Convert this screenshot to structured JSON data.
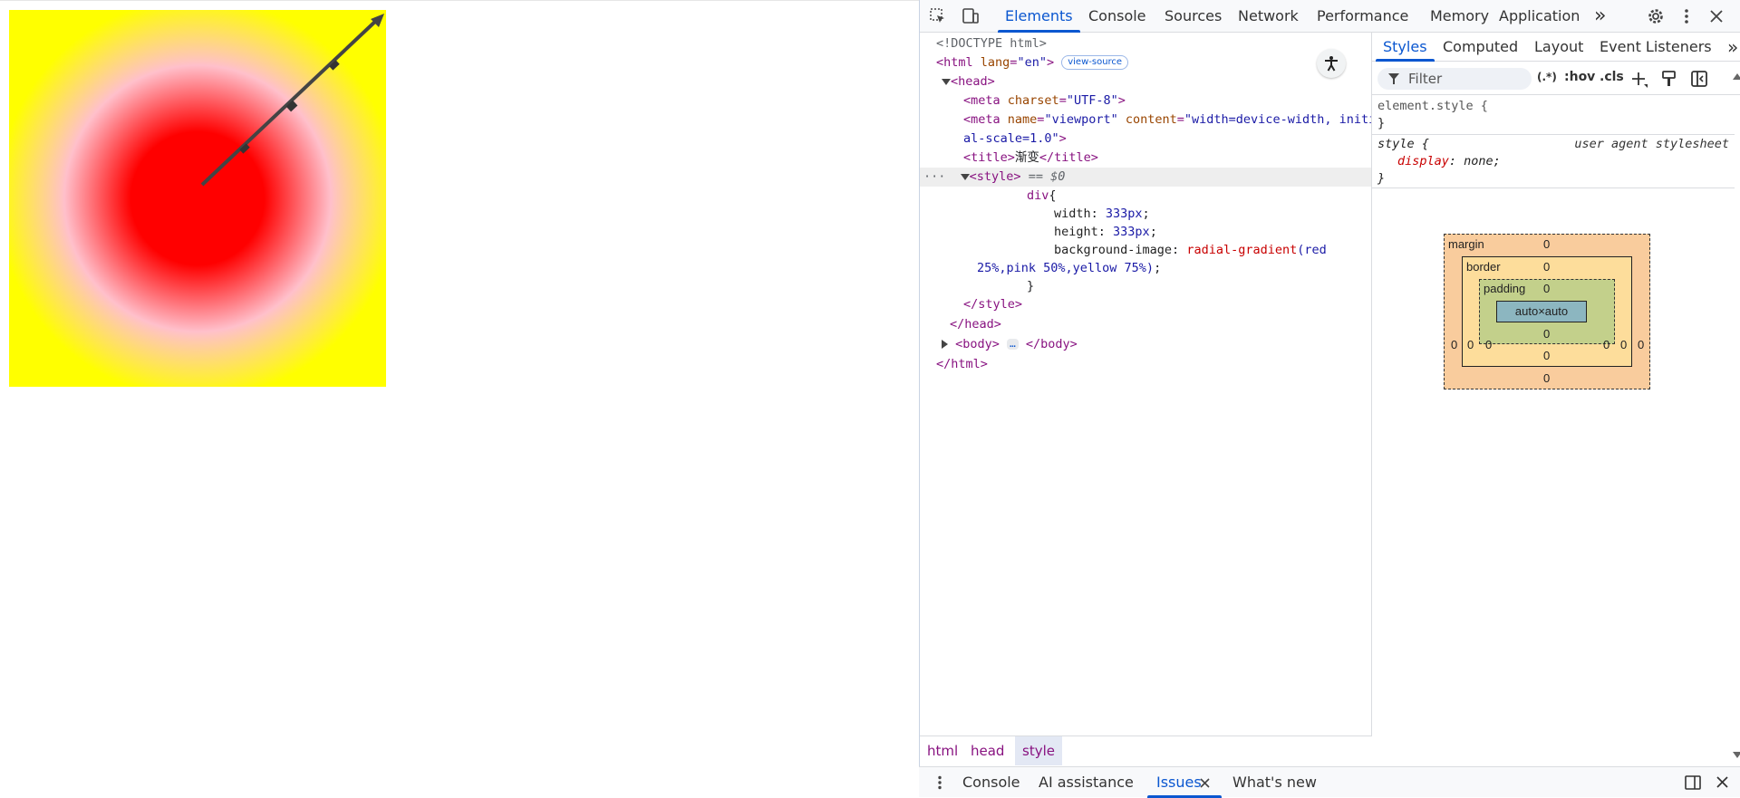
{
  "devtools": {
    "main_tabs": [
      "Elements",
      "Console",
      "Sources",
      "Network",
      "Performance",
      "Memory",
      "Application"
    ],
    "overflow": "»",
    "dom_tree": {
      "doctype": "<!DOCTYPE html>",
      "html_open_tag": "<html",
      "html_lang_attr": "lang",
      "html_lang_value": "\"en\"",
      "view_source_badge": "view-source",
      "head_open": "<head>",
      "meta_charset": {
        "tag": "<meta",
        "attr": "charset",
        "value": "\"UTF-8\"",
        "close": ">"
      },
      "meta_viewport": {
        "tag": "<meta",
        "attr1": "name",
        "val1": "\"viewport\"",
        "attr2": "content",
        "val2_line1": "\"width=device-width, initi",
        "val2_line2": "al-scale=1.0\"",
        "close": ">"
      },
      "title": {
        "open": "<title>",
        "text": "渐变",
        "close": "</title>"
      },
      "style_open": "<style>",
      "selected_marker": "== $0",
      "css_selector": "div",
      "css_brace_open": "{",
      "css_width_prop": "width",
      "css_width_val": "333px",
      "css_height_prop": "height",
      "css_height_val": "333px",
      "css_bg_prop": "background-image",
      "css_bg_fn": "radial-gradient",
      "css_bg_arg1": "(red",
      "css_bg_line2": "25%,pink 50%,yellow 75%)",
      "css_brace_close": "}",
      "style_close": "</style>",
      "head_close": "</head>",
      "body_open": "<body>",
      "body_dots": "…",
      "body_close": "</body>",
      "html_close": "</html>"
    },
    "breadcrumbs": [
      "html",
      "head",
      "style"
    ],
    "styles_tabs": [
      "Styles",
      "Computed",
      "Layout",
      "Event Listeners"
    ],
    "filter_placeholder": "Filter",
    "filter_tools": {
      "regex": "(.*)",
      "hov": ":hov",
      "cls": ".cls"
    },
    "rules": {
      "element_style": "element.style {",
      "element_style_close": "}",
      "ua_selector": "style {",
      "ua_source": "user agent stylesheet",
      "ua_prop": "display",
      "ua_value": "none;",
      "ua_close": "}"
    },
    "box_model": {
      "margin_label": "margin",
      "border_label": "border",
      "padding_label": "padding",
      "content": "auto×auto",
      "margin": {
        "top": "0",
        "right": "0",
        "bottom": "0",
        "left": "0"
      },
      "border": {
        "top": "0",
        "right": "0",
        "bottom": "0",
        "left": "0"
      },
      "padding": {
        "top": "0",
        "right": "0",
        "bottom": "0",
        "left": "0"
      }
    },
    "drawer_tabs": [
      "Console",
      "AI assistance",
      "Issues",
      "What's new"
    ]
  }
}
